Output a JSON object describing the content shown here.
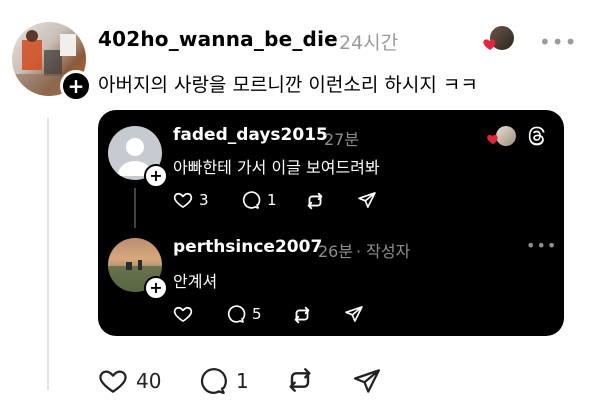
{
  "post": {
    "username": "402ho_wanna_be_die",
    "time": "24시간",
    "text": "아버지의 사랑을 모르니깐 이런소리 하시지 ㅋㅋ",
    "more": "•••",
    "likes": "40",
    "comments": "1"
  },
  "quote": {
    "first": {
      "username": "faded_days2015",
      "time": "27분",
      "text": "아빠한테 가서 이글 보여드려봐",
      "likes": "3",
      "comments": "1"
    },
    "second": {
      "username": "perthsince2007",
      "time": "26분",
      "author_tag": "· 작성자",
      "text": "안계셔",
      "more": "•••",
      "likes": "",
      "comments": "5"
    }
  },
  "colors": {
    "heart_red": "#e3263b",
    "muted": "#9a9a9a"
  }
}
